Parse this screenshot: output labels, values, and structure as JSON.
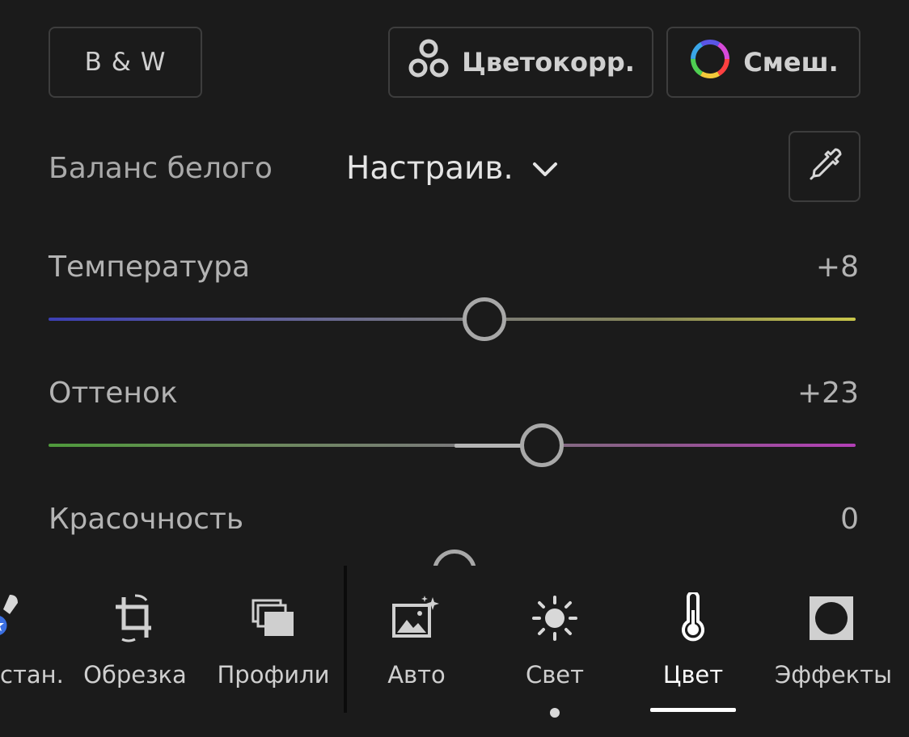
{
  "top_buttons": {
    "bw": "B & W",
    "grading": "Цветокорр.",
    "mix": "Смеш."
  },
  "white_balance": {
    "label": "Баланс белого",
    "value": "Настраив."
  },
  "sliders": {
    "temperature": {
      "label": "Температура",
      "value": "+8"
    },
    "tint": {
      "label": "Оттенок",
      "value": "+23"
    },
    "vibrance": {
      "label": "Красочность",
      "value": "0"
    }
  },
  "toolbar": {
    "items": [
      {
        "label": "стан.",
        "icon": "healing-brush-icon"
      },
      {
        "label": "Обрезка",
        "icon": "crop-rotate-icon"
      },
      {
        "label": "Профили",
        "icon": "profiles-icon"
      },
      {
        "label": "Авто",
        "icon": "auto-image-icon"
      },
      {
        "label": "Свет",
        "icon": "sun-icon"
      },
      {
        "label": "Цвет",
        "icon": "thermometer-icon",
        "active": true
      },
      {
        "label": "Эффекты",
        "icon": "effects-vignette-icon"
      }
    ]
  },
  "colors": {
    "background": "#1b1b1b",
    "border": "#3d3d3d",
    "badge_blue": "#3b6fe0",
    "temperature_cool": "#3c3fb4",
    "temperature_warm": "#c9c64a",
    "tint_green": "#4f9a3c",
    "tint_magenta": "#b33fb6"
  }
}
